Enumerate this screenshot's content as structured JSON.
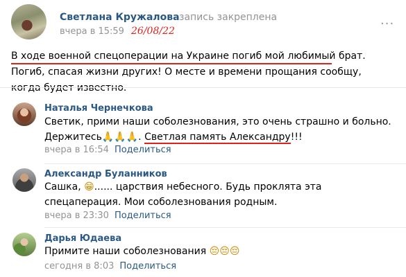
{
  "post": {
    "author": "Светлана Кружалова",
    "pinned_label": "запись закреплена",
    "time": "вчера в 15:59",
    "handwritten_date": "26/08/22",
    "more_icon": "three-dots-icon",
    "text": "В ходе военной спецоперации на Украине погиб мой любимый брат. Погиб, спасая жизни других! О месте и времени прощания сообщу, когда будет известно."
  },
  "comments": [
    {
      "author": "Наталья Чернечкова",
      "text_part1": "Светик, прими наши соболезнования, это очень страшно и больно. Держитесь",
      "emoji": "🙏🙏🙏",
      "text_part2": ". ",
      "highlight": "Светлая память Александру",
      "text_part3": "!!!",
      "time": "вчера в 16:54",
      "reply": "Поделиться"
    },
    {
      "author": "Александр Буланников",
      "text_part1": "Сашка, ",
      "emoji": "😁",
      "text_part2": "...... царствия небесного. Будь проклята эта спецаперация. Мои соболезнования родным.",
      "time": "вчера в 23:30",
      "reply": "Поделиться"
    },
    {
      "author": "Дарья Юдаева",
      "text_part1": "Примите наши соболезнования ",
      "emoji": "😔😔😔",
      "time": "сегодня в 8:03",
      "reply": "Поделиться"
    }
  ],
  "colors": {
    "link": "#2a5885",
    "meta": "#939393",
    "annotation_red": "#e0201b"
  }
}
